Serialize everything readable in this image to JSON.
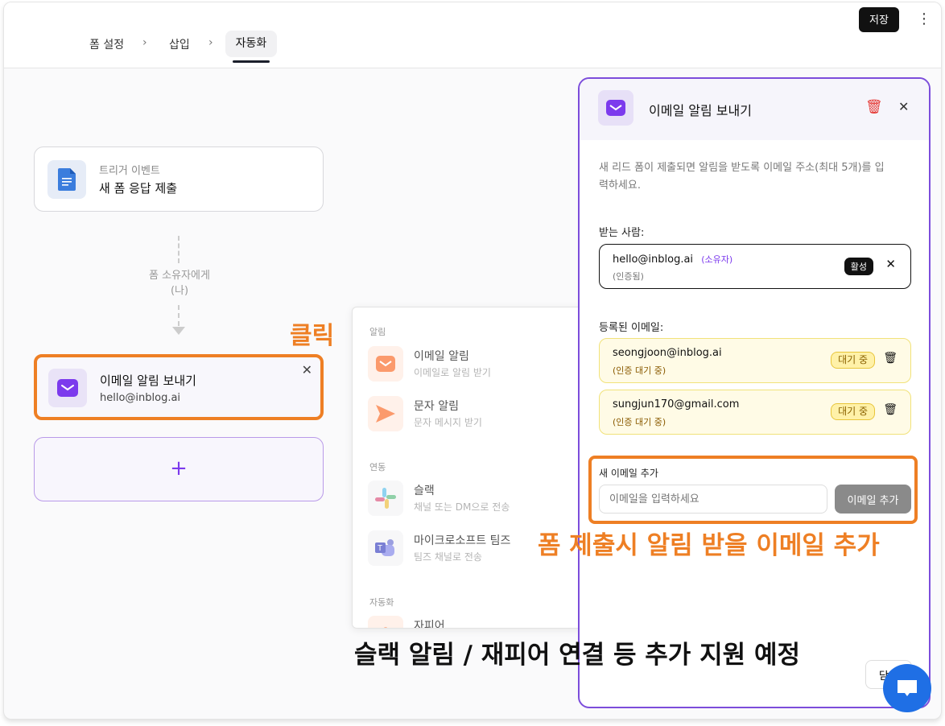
{
  "header": {
    "breadcrumbs": [
      "폼 설정",
      "삽입",
      "자동화"
    ],
    "save_label": "저장",
    "more_icon": "⋮"
  },
  "flow": {
    "trigger": {
      "label": "트리거 이벤트",
      "title": "새 폼 응답 제출"
    },
    "connector": {
      "line1": "폼 소유자에게",
      "line2": "(나)"
    },
    "action": {
      "title": "이메일 알림 보내기",
      "email": "hello@inblog.ai"
    },
    "add_label": "+"
  },
  "menu": {
    "sections": [
      {
        "label": "알림",
        "items": [
          {
            "title": "이메일 알림",
            "subtitle": "이메일로 알림 받기"
          },
          {
            "title": "문자 알림",
            "subtitle": "문자 메시지 받기"
          }
        ]
      },
      {
        "label": "연동",
        "items": [
          {
            "title": "슬랙",
            "subtitle": "채널 또는 DM으로 전송"
          },
          {
            "title": "마이크로소프트 팀즈",
            "subtitle": "팀즈 채널로 전송"
          }
        ]
      },
      {
        "label": "자동화",
        "items": [
          {
            "title": "자피어"
          }
        ]
      }
    ]
  },
  "panel": {
    "title": "이메일 알림 보내기",
    "description": "새 리드 폼이 제출되면 알림을 받도록 이메일 주소(최대 5개)를 입력하세요.",
    "recipient_label": "받는 사람:",
    "recipient": {
      "email": "hello@inblog.ai",
      "role": "(소유자)",
      "status": "(인증됨)",
      "badge": "활성"
    },
    "registered_label": "등록된 이메일:",
    "registered": [
      {
        "email": "seongjoon@inblog.ai",
        "status": "(인증 대기 중)",
        "badge": "대기 중"
      },
      {
        "email": "sungjun170@gmail.com",
        "status": "(인증 대기 중)",
        "badge": "대기 중"
      }
    ],
    "add_label": "새 이메일 추가",
    "input_placeholder": "이메일을 입력하세요",
    "input_value": "",
    "add_button": "이메일 추가",
    "close_button": "닫기"
  },
  "annotations": {
    "click": "클릭",
    "add_email": "폼 제출시 알림 받을 이메일 추가",
    "coming_soon": "슬랙 알림 / 재피어 연결 등 추가 지원 예정"
  },
  "colors": {
    "accent": "#7c4ddb",
    "annotation": "#ee7f24",
    "danger": "#e53935",
    "chat": "#1f6fe5"
  }
}
